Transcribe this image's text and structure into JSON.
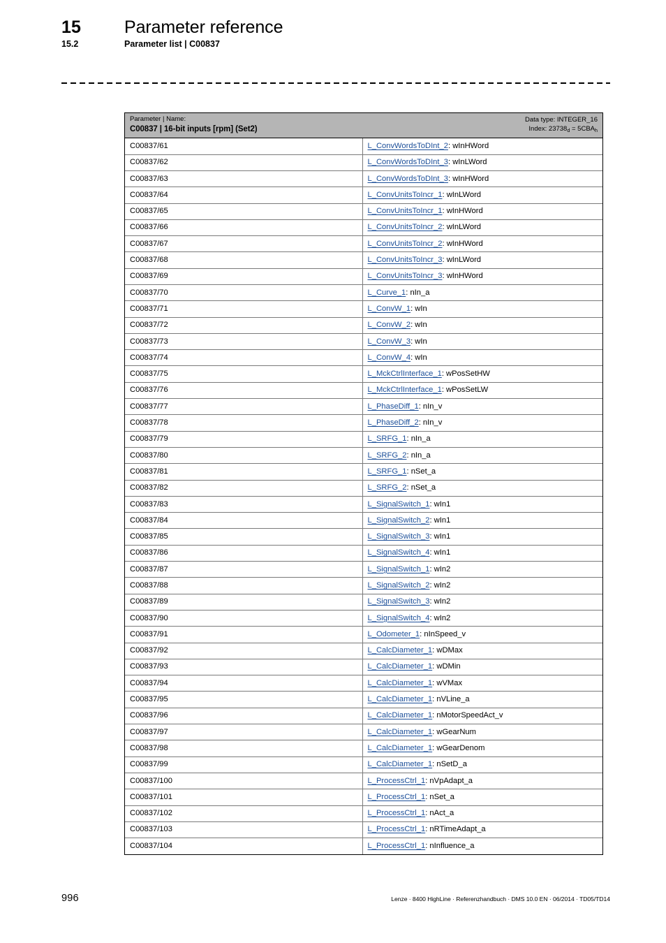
{
  "header": {
    "chapter_number": "15",
    "chapter_title": "Parameter reference",
    "section_number": "15.2",
    "section_title": "Parameter list | C00837"
  },
  "table_header": {
    "column_label": "Parameter | Name:",
    "parameter_title": "C00837 | 16-bit inputs [rpm] (Set2)",
    "data_type_line": "Data type: INTEGER_16",
    "index_prefix": "Index: ",
    "index_dec": "23738",
    "index_dec_sub": "d",
    "index_eq": " = ",
    "index_hex": "5CBA",
    "index_hex_sub": "h"
  },
  "columns": {
    "parameter": "Parameter",
    "name": "Name"
  },
  "colors": {
    "header_band": "#b5b5b5",
    "link": "#1c4f99",
    "grid": "#7a7a7a",
    "border": "#000000"
  },
  "rows": [
    {
      "parameter": "C00837/61",
      "fb": "L_ConvWordsToDInt_2",
      "port": "wInHWord"
    },
    {
      "parameter": "C00837/62",
      "fb": "L_ConvWordsToDInt_3",
      "port": "wInLWord"
    },
    {
      "parameter": "C00837/63",
      "fb": "L_ConvWordsToDInt_3",
      "port": "wInHWord"
    },
    {
      "parameter": "C00837/64",
      "fb": "L_ConvUnitsToIncr_1",
      "port": "wInLWord"
    },
    {
      "parameter": "C00837/65",
      "fb": "L_ConvUnitsToIncr_1",
      "port": "wInHWord"
    },
    {
      "parameter": "C00837/66",
      "fb": "L_ConvUnitsToIncr_2",
      "port": "wInLWord"
    },
    {
      "parameter": "C00837/67",
      "fb": "L_ConvUnitsToIncr_2",
      "port": "wInHWord"
    },
    {
      "parameter": "C00837/68",
      "fb": "L_ConvUnitsToIncr_3",
      "port": "wInLWord"
    },
    {
      "parameter": "C00837/69",
      "fb": "L_ConvUnitsToIncr_3",
      "port": "wInHWord"
    },
    {
      "parameter": "C00837/70",
      "fb": "L_Curve_1",
      "port": "nIn_a"
    },
    {
      "parameter": "C00837/71",
      "fb": "L_ConvW_1",
      "port": "wIn"
    },
    {
      "parameter": "C00837/72",
      "fb": "L_ConvW_2",
      "port": "wIn"
    },
    {
      "parameter": "C00837/73",
      "fb": "L_ConvW_3",
      "port": "wIn"
    },
    {
      "parameter": "C00837/74",
      "fb": "L_ConvW_4",
      "port": "wIn"
    },
    {
      "parameter": "C00837/75",
      "fb": "L_MckCtrlInterface_1",
      "port": "wPosSetHW"
    },
    {
      "parameter": "C00837/76",
      "fb": "L_MckCtrlInterface_1",
      "port": "wPosSetLW"
    },
    {
      "parameter": "C00837/77",
      "fb": "L_PhaseDiff_1",
      "port": "nIn_v"
    },
    {
      "parameter": "C00837/78",
      "fb": "L_PhaseDiff_2",
      "port": "nIn_v"
    },
    {
      "parameter": "C00837/79",
      "fb": "L_SRFG_1",
      "port": "nIn_a"
    },
    {
      "parameter": "C00837/80",
      "fb": "L_SRFG_2",
      "port": "nIn_a"
    },
    {
      "parameter": "C00837/81",
      "fb": "L_SRFG_1",
      "port": "nSet_a"
    },
    {
      "parameter": "C00837/82",
      "fb": "L_SRFG_2",
      "port": "nSet_a"
    },
    {
      "parameter": "C00837/83",
      "fb": "L_SignalSwitch_1",
      "port": "wIn1"
    },
    {
      "parameter": "C00837/84",
      "fb": "L_SignalSwitch_2",
      "port": "wIn1"
    },
    {
      "parameter": "C00837/85",
      "fb": "L_SignalSwitch_3",
      "port": "wIn1"
    },
    {
      "parameter": "C00837/86",
      "fb": "L_SignalSwitch_4",
      "port": "wIn1"
    },
    {
      "parameter": "C00837/87",
      "fb": "L_SignalSwitch_1",
      "port": "wIn2"
    },
    {
      "parameter": "C00837/88",
      "fb": "L_SignalSwitch_2",
      "port": "wIn2"
    },
    {
      "parameter": "C00837/89",
      "fb": "L_SignalSwitch_3",
      "port": "wIn2"
    },
    {
      "parameter": "C00837/90",
      "fb": "L_SignalSwitch_4",
      "port": "wIn2"
    },
    {
      "parameter": "C00837/91",
      "fb": "L_Odometer_1",
      "port": "nInSpeed_v"
    },
    {
      "parameter": "C00837/92",
      "fb": "L_CalcDiameter_1",
      "port": "wDMax"
    },
    {
      "parameter": "C00837/93",
      "fb": "L_CalcDiameter_1",
      "port": "wDMin"
    },
    {
      "parameter": "C00837/94",
      "fb": "L_CalcDiameter_1",
      "port": "wVMax"
    },
    {
      "parameter": "C00837/95",
      "fb": "L_CalcDiameter_1",
      "port": "nVLine_a"
    },
    {
      "parameter": "C00837/96",
      "fb": "L_CalcDiameter_1",
      "port": "nMotorSpeedAct_v"
    },
    {
      "parameter": "C00837/97",
      "fb": "L_CalcDiameter_1",
      "port": "wGearNum"
    },
    {
      "parameter": "C00837/98",
      "fb": "L_CalcDiameter_1",
      "port": "wGearDenom"
    },
    {
      "parameter": "C00837/99",
      "fb": "L_CalcDiameter_1",
      "port": "nSetD_a"
    },
    {
      "parameter": "C00837/100",
      "fb": "L_ProcessCtrl_1",
      "port": "nVpAdapt_a"
    },
    {
      "parameter": "C00837/101",
      "fb": "L_ProcessCtrl_1",
      "port": "nSet_a"
    },
    {
      "parameter": "C00837/102",
      "fb": "L_ProcessCtrl_1",
      "port": "nAct_a"
    },
    {
      "parameter": "C00837/103",
      "fb": "L_ProcessCtrl_1",
      "port": "nRTimeAdapt_a"
    },
    {
      "parameter": "C00837/104",
      "fb": "L_ProcessCtrl_1",
      "port": "nInfluence_a"
    }
  ],
  "footer": {
    "page_number": "996",
    "credit": "Lenze · 8400 HighLine · Referenzhandbuch · DMS 10.0 EN · 06/2014 · TD05/TD14"
  }
}
